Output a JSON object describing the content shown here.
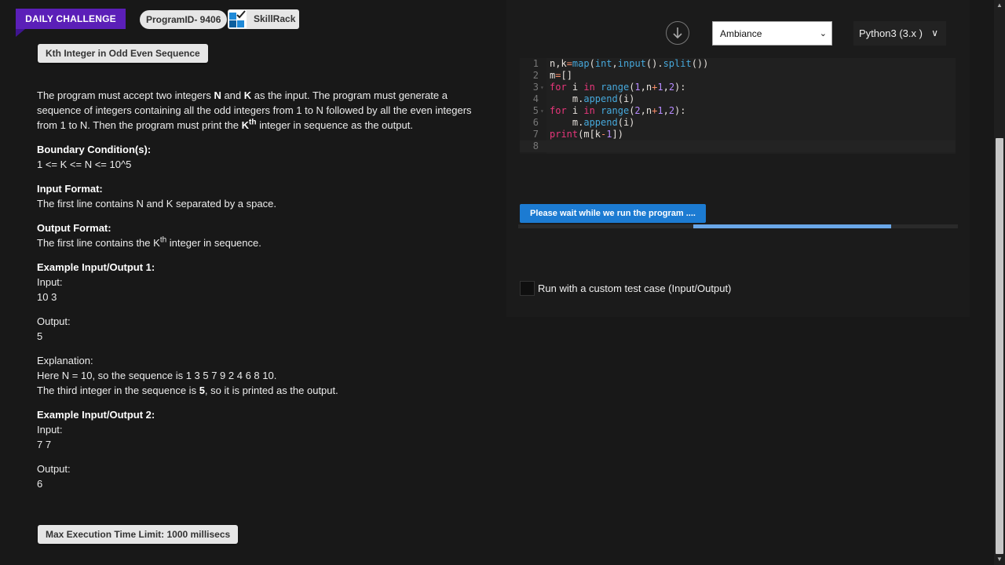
{
  "header": {
    "daily_challenge": "DAILY CHALLENGE",
    "program_id": "ProgramID- 9406",
    "brand": "SkillRack"
  },
  "problem": {
    "title": "Kth Integer in Odd Even Sequence",
    "para_a": "The program must accept two integers ",
    "n": "N",
    "and": " and ",
    "k": "K",
    "para_b": " as the input. The program must generate a sequence of integers containing all the odd integers from 1 to N followed by all the even integers from 1 to N. Then the program must print the ",
    "kth_k": "K",
    "kth_sup": "th",
    "para_c": " integer in sequence as the output.",
    "boundary_title": "Boundary Condition(s):",
    "boundary": "1 <= K <= N <= 10^5",
    "input_format_title": "Input Format:",
    "input_format": "The first line contains N and K separated by a space.",
    "output_format_title": "Output Format:",
    "output_a": "The first line contains the K",
    "output_sup": "th",
    "output_b": " integer in sequence.",
    "ex1_title": "Example Input/Output 1:",
    "input_label": "Input:",
    "ex1_input": "10 3",
    "output_label": "Output:",
    "ex1_output": "5",
    "explanation_label": "Explanation:",
    "explanation_line1": "Here N = 10, so the sequence is 1 3 5 7 9 2 4 6 8 10.",
    "explanation_a": "The third integer in the sequence is ",
    "explanation_b": "5",
    "explanation_c": ", so it is printed as the output.",
    "ex2_title": "Example Input/Output 2:",
    "ex2_input": "7 7",
    "ex2_output": "6",
    "time_limit": "Max Execution Time Limit: 1000 millisecs"
  },
  "toolbar": {
    "download_icon": "arrow-down-circle-icon",
    "theme": "Ambiance",
    "language": "Python3 (3.x )"
  },
  "editor": {
    "line_numbers": [
      "1",
      "2",
      "3",
      "4",
      "5",
      "6",
      "7",
      "8"
    ]
  },
  "run": {
    "status": "Please wait while we run the program ....",
    "progress": 0.45,
    "progress_start": 0.398,
    "custom_label": "Run with a custom test case (Input/Output)"
  },
  "colors": {
    "daily": "#5b1fb8",
    "run_button": "#1c7bd2",
    "progress": "#6aa7e8"
  }
}
